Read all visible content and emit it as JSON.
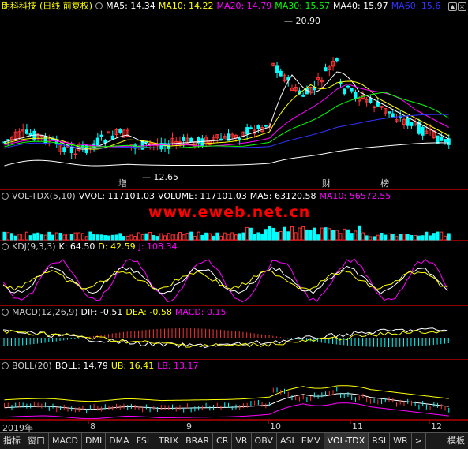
{
  "main": {
    "stock_name": "朗科科技",
    "period": "(日线 前复权)",
    "ma": [
      {
        "label": "MA5: 14.34",
        "color": "#ffffff"
      },
      {
        "label": "MA10: 14.22",
        "color": "#ffff00"
      },
      {
        "label": "MA20: 14.79",
        "color": "#ff00ff"
      },
      {
        "label": "MA30: 15.57",
        "color": "#00ff00"
      },
      {
        "label": "MA40: 15.97",
        "color": "#ffffff"
      },
      {
        "label": "MA60: 15.6",
        "color": "#0000ff"
      }
    ],
    "high_label": "20.90",
    "low_label": "12.65",
    "marks": [
      "增",
      "财",
      "榜"
    ]
  },
  "volume": {
    "name": "VOL-TDX(5,10)",
    "vvol": "VVOL: 117101.03",
    "volume": "VOLUME: 117101.03",
    "ma5": "MA5: 63120.58",
    "ma10": "MA10: 56572.55"
  },
  "kdj": {
    "name": "KDJ(9,3,3)",
    "k": "K: 64.50",
    "d": "D: 42.59",
    "j": "J: 108.34"
  },
  "macd": {
    "name": "MACD(12,26,9)",
    "dif": "DIF: -0.51",
    "dea": "DEA: -0.58",
    "macd": "MACD: 0.15"
  },
  "boll": {
    "name": "BOLL(20)",
    "boll": "BOLL: 14.79",
    "ub": "UB: 16.41",
    "lb": "LB: 13.17"
  },
  "watermark": "www.eweb.net.cn",
  "xaxis": [
    "2019年",
    "8",
    "9",
    "10",
    "11",
    "12"
  ],
  "tabs": [
    "指标",
    "窗口",
    "MACD",
    "DMI",
    "DMA",
    "FSL",
    "TRIX",
    "BRAR",
    "CR",
    "VR",
    "OBV",
    "ASI",
    "EMV",
    "VOL-TDX",
    "RSI",
    "WR",
    ">",
    "模板"
  ]
}
